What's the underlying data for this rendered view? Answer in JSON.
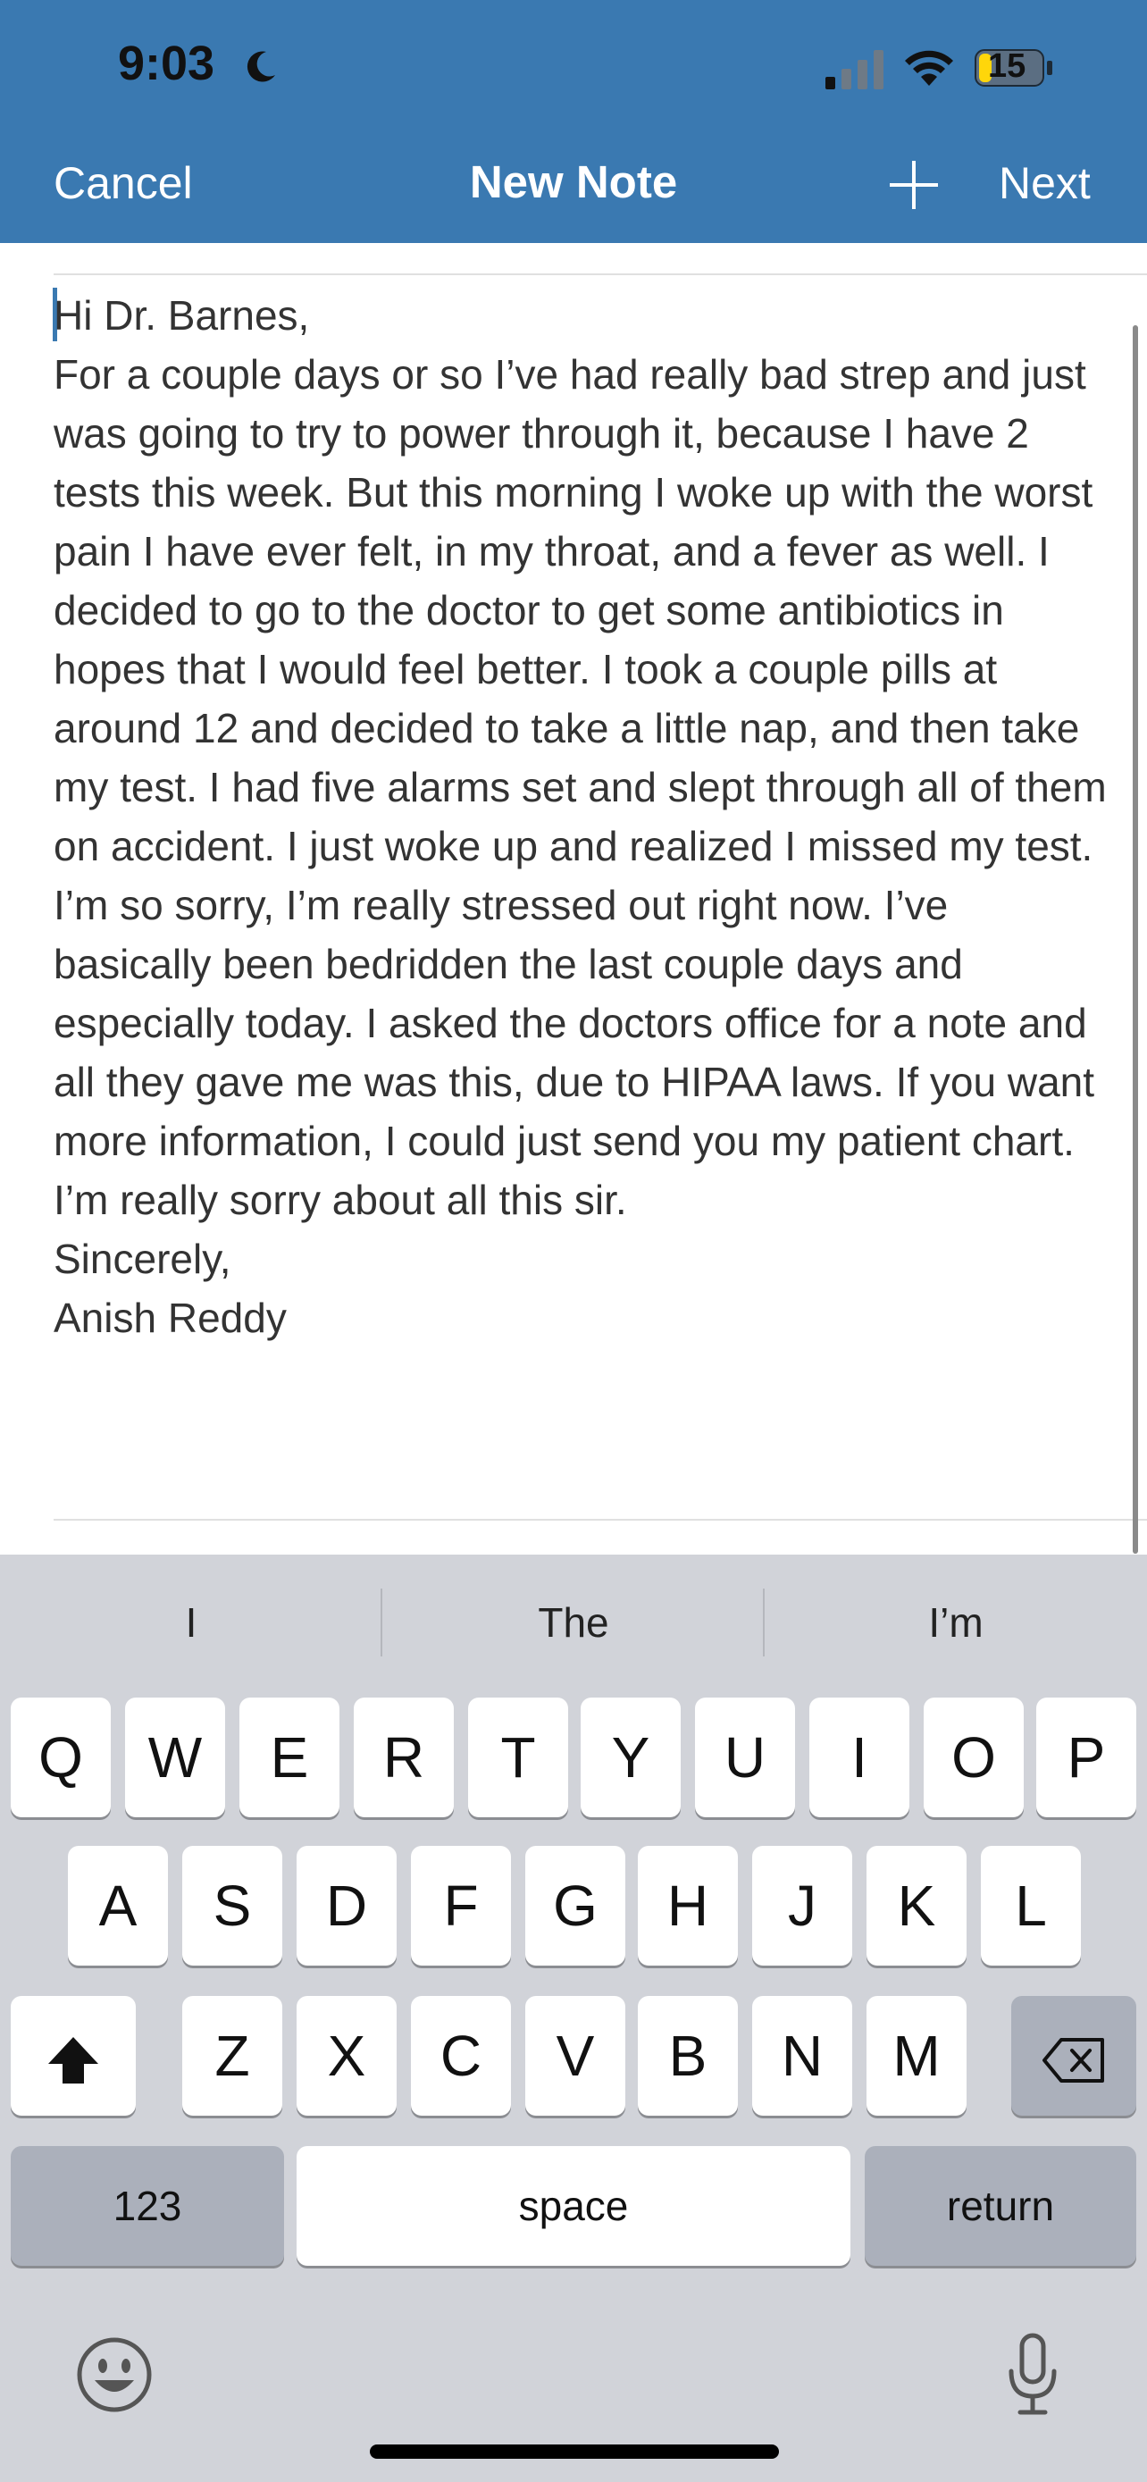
{
  "status_bar": {
    "time": "9:03",
    "battery_level": "15"
  },
  "nav": {
    "cancel_label": "Cancel",
    "title": "New Note",
    "next_label": "Next"
  },
  "note": {
    "greeting": "Hi Dr. Barnes,",
    "body": "For a couple days or so I’ve had really bad strep and just was going to try to power through it, because I have 2 tests this week. But this morning I woke up with the worst pain I have ever felt, in my throat, and a fever as well. I decided to go to the doctor to get some antibiotics in hopes that I would feel better. I took a couple pills at around 12 and decided to take a little nap, and then take my test. I had five alarms set and slept through all of them on accident. I just woke up and realized I missed my test. I’m so sorry, I’m really stressed out right now. I’ve basically been bedridden the last couple days and especially today. I asked the doctors office for a note and all they gave me was this, due to HIPAA laws. If you want more information, I could just send you my patient chart.",
    "apology": "I’m really sorry about all this sir.",
    "closing": "Sincerely,",
    "signature": "Anish Reddy"
  },
  "keyboard": {
    "suggestions": [
      "I",
      "The",
      "I’m"
    ],
    "row1": [
      "Q",
      "W",
      "E",
      "R",
      "T",
      "Y",
      "U",
      "I",
      "O",
      "P"
    ],
    "row2": [
      "A",
      "S",
      "D",
      "F",
      "G",
      "H",
      "J",
      "K",
      "L"
    ],
    "row3": [
      "Z",
      "X",
      "C",
      "V",
      "B",
      "N",
      "M"
    ],
    "numbers_label": "123",
    "space_label": "space",
    "return_label": "return"
  },
  "colors": {
    "header_bg": "#3a79b1",
    "keyboard_bg": "#d1d3d9",
    "key_bg": "#ffffff",
    "special_key_bg": "#abb0bb"
  },
  "icons": [
    "moon-icon",
    "signal-icon",
    "wifi-icon",
    "battery-icon",
    "plus-icon",
    "shift-icon",
    "backspace-icon",
    "emoji-icon",
    "microphone-icon"
  ]
}
